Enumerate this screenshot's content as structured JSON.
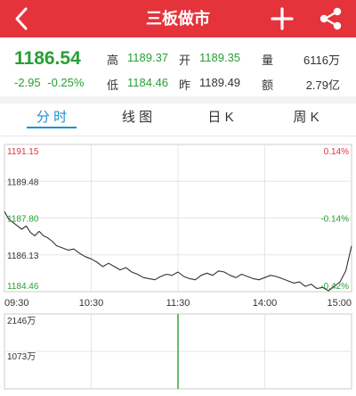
{
  "header": {
    "title": "三板做市",
    "back_icon": "chevron-left-icon",
    "add_icon": "plus-icon",
    "share_icon": "share-icon",
    "bar_color": "#e5333b"
  },
  "quote": {
    "price": "1186.54",
    "change": "-2.95",
    "change_pct": "-0.25%",
    "high_label": "高",
    "high": "1189.37",
    "open_label": "开",
    "open": "1189.35",
    "volume_label": "量",
    "volume": "6116万",
    "low_label": "低",
    "low": "1184.46",
    "prev_label": "昨",
    "prev": "1189.49",
    "amount_label": "额",
    "amount": "2.79亿",
    "down_color": "#27a036"
  },
  "tabs": [
    {
      "label": "分 时",
      "active": true
    },
    {
      "label": "线 图",
      "active": false
    },
    {
      "label": "日 K",
      "active": false
    },
    {
      "label": "周 K",
      "active": false
    }
  ],
  "chart_data": {
    "type": "line",
    "y_ticks_left": [
      "1191.15",
      "1189.48",
      "1187.80",
      "1186.13",
      "1184.46"
    ],
    "y_ticks_right": [
      "0.14%",
      "",
      "-0.14%",
      "",
      "-0.42%"
    ],
    "ylim": [
      1184.46,
      1191.15
    ],
    "x_ticks": [
      "09:30",
      "10:30",
      "11:30",
      "14:00",
      "15:00"
    ],
    "series": [
      {
        "x": [
          0,
          3,
          6,
          9,
          12,
          15,
          18,
          21,
          24,
          27,
          30,
          33,
          36,
          40,
          44,
          48,
          52,
          56,
          60,
          64,
          68,
          72,
          76,
          80,
          84,
          88,
          92,
          96,
          100,
          104,
          108,
          112,
          116,
          120,
          124,
          128,
          132,
          136,
          140,
          144,
          148,
          152,
          156,
          160,
          164,
          168,
          172,
          176,
          180,
          184,
          188,
          192,
          196,
          200,
          204,
          208,
          212,
          216,
          220,
          224,
          228,
          232,
          236,
          240
        ],
        "values": [
          1188.1,
          1187.75,
          1187.6,
          1187.45,
          1187.3,
          1187.45,
          1187.15,
          1187.0,
          1187.2,
          1187.0,
          1186.9,
          1186.75,
          1186.55,
          1186.45,
          1186.35,
          1186.4,
          1186.2,
          1186.05,
          1185.95,
          1185.8,
          1185.6,
          1185.75,
          1185.6,
          1185.45,
          1185.55,
          1185.35,
          1185.25,
          1185.1,
          1185.05,
          1185.0,
          1185.15,
          1185.25,
          1185.2,
          1185.35,
          1185.15,
          1185.05,
          1185.0,
          1185.2,
          1185.3,
          1185.2,
          1185.4,
          1185.35,
          1185.2,
          1185.1,
          1185.25,
          1185.15,
          1185.05,
          1185.0,
          1185.1,
          1185.2,
          1185.15,
          1185.05,
          1184.95,
          1184.85,
          1184.9,
          1184.7,
          1184.8,
          1184.6,
          1184.65,
          1184.5,
          1184.7,
          1184.9,
          1185.4,
          1186.54
        ]
      }
    ],
    "volume_labels": [
      "2146万",
      "1073万"
    ],
    "volume_max": 2146,
    "volume_bar_x": 120,
    "line_color": "#333333",
    "volume_color": "#27a036",
    "grid": true
  }
}
